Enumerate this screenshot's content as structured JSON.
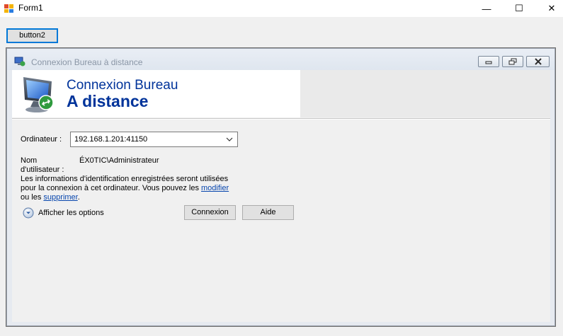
{
  "window": {
    "title": "Form1",
    "minimize_glyph": "—",
    "maximize_glyph": "☐",
    "close_glyph": "✕"
  },
  "toolbar": {
    "button2_label": "button2"
  },
  "rdp": {
    "title": "Connexion Bureau à distance",
    "banner_line1": "Connexion Bureau",
    "banner_line2": "A distance",
    "computer_label": "Ordinateur :",
    "computer_value": "192.168.1.201:41150",
    "username_label_line1": "Nom",
    "username_label_line2": "d'utilisateur :",
    "username_value": "ÉX0TIC\\Administrateur",
    "info_text_1": "Les informations d'identification enregistrées seront utilisées pour la connexion à cet ordinateur. Vous pouvez les ",
    "modify_link": "modifier",
    "info_text_2": " ou les ",
    "delete_link": "supprimer",
    "info_text_3": ".",
    "show_options_label": "Afficher les options",
    "connect_label": "Connexion",
    "help_label": "Aide"
  },
  "colors": {
    "banner_text": "#00339a",
    "link": "#0645ad",
    "focus_border": "#0078d7"
  },
  "icons": {
    "app": "form-icon",
    "rdp": "remote-desktop-icon",
    "options": "chevron-down-circle-icon",
    "combo": "chevron-down-icon"
  }
}
